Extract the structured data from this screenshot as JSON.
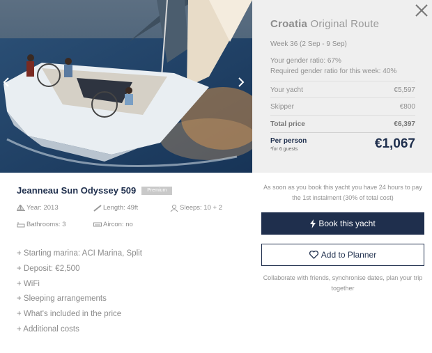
{
  "route": {
    "country": "Croatia",
    "name": "Original Route"
  },
  "week": "Week 36 (2 Sep - 9 Sep)",
  "gender": {
    "your_ratio": "Your gender ratio: 67%",
    "required_ratio": "Required gender ratio for this week: 40%"
  },
  "pricing": {
    "rows": [
      {
        "label": "Your yacht",
        "value": "€5,597"
      },
      {
        "label": "Skipper",
        "value": "€800"
      }
    ],
    "total": {
      "label": "Total price",
      "value": "€6,397"
    },
    "per_person": {
      "label": "Per person",
      "note": "*for 6 guests",
      "value": "€1,067"
    }
  },
  "yacht": {
    "name": "Jeanneau Sun Odyssey 509",
    "badge": "Premium",
    "specs": {
      "year": "Year: 2013",
      "length": "Length: 49ft",
      "sleeps": "Sleeps: 10 + 2",
      "bathrooms": "Bathrooms: 3",
      "aircon": "Aircon: no"
    },
    "features": [
      "+ Starting marina: ACI Marina, Split",
      "+ Deposit: €2,500",
      "+ WiFi",
      "+ Sleeping arrangements",
      "+ What's included in the price",
      "+ Additional costs"
    ]
  },
  "booking": {
    "notice": "As soon as you book this yacht you have 24 hours to pay the 1st instalment (30% of total cost)",
    "book_label": "Book this yacht",
    "planner_label": "Add to Planner",
    "collab": "Collaborate with friends, synchronise dates, plan your trip together"
  },
  "icons": {
    "close": "close-icon",
    "prev": "chevron-left-icon",
    "next": "chevron-right-icon",
    "book": "lightning-icon",
    "planner": "heart-icon"
  },
  "colors": {
    "navy": "#1f2f4d",
    "panel": "#efefef",
    "badge": "#c9c9c9"
  }
}
